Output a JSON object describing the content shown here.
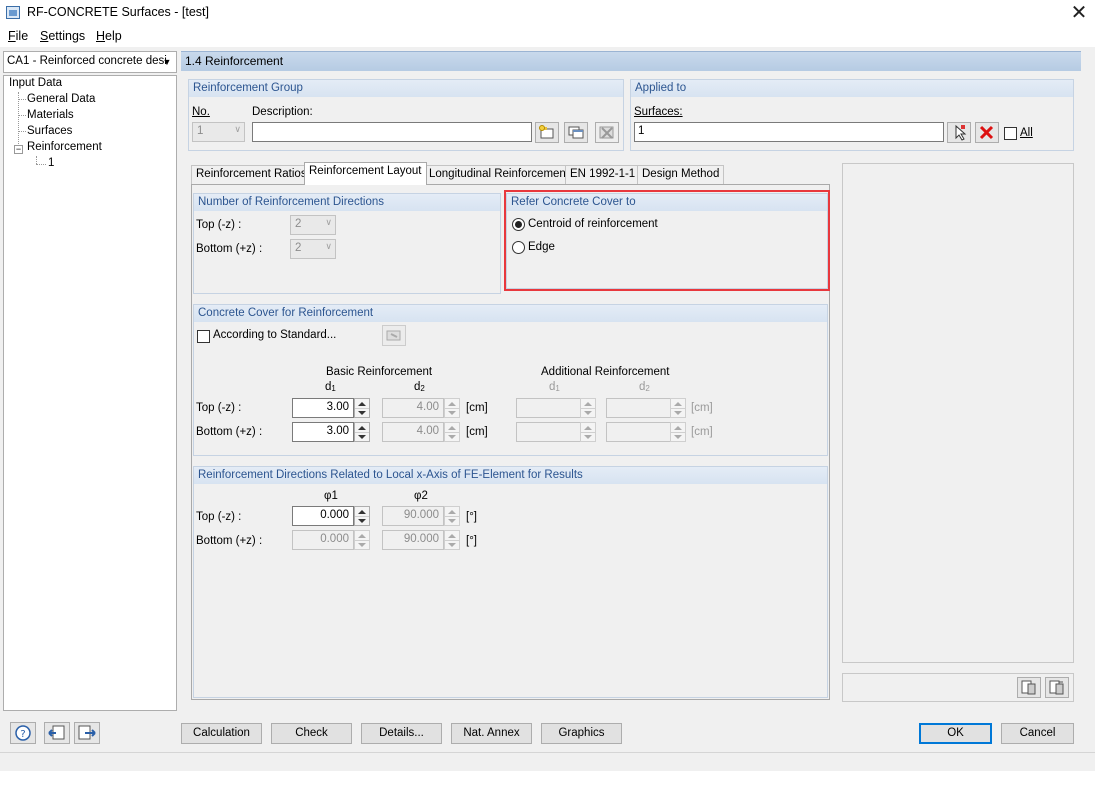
{
  "window": {
    "title": "RF-CONCRETE Surfaces - [test]"
  },
  "menu": {
    "items": [
      "File",
      "Settings",
      "Help"
    ]
  },
  "nav": {
    "case_select": "CA1 - Reinforced concrete desi",
    "root": "Input Data",
    "items": [
      "General Data",
      "Materials",
      "Surfaces",
      "Reinforcement"
    ],
    "sub_item": "1"
  },
  "header": {
    "title": "1.4 Reinforcement"
  },
  "reinforcement_group": {
    "title": "Reinforcement Group",
    "no_label": "No.",
    "no_value": "1",
    "description_label": "Description:",
    "description_value": ""
  },
  "applied_to": {
    "title": "Applied to",
    "surfaces_label": "Surfaces:",
    "surfaces_value": "1",
    "all_label": "All"
  },
  "tabs": [
    {
      "label": "Reinforcement Ratios"
    },
    {
      "label": "Reinforcement Layout"
    },
    {
      "label": "Longitudinal Reinforcement"
    },
    {
      "label": "EN 1992-1-1"
    },
    {
      "label": "Design Method"
    }
  ],
  "num_directions": {
    "title": "Number of Reinforcement Directions",
    "top_label": "Top (-z) :",
    "top_value": "2",
    "bottom_label": "Bottom (+z) :",
    "bottom_value": "2"
  },
  "refer_cover": {
    "title": "Refer Concrete Cover to",
    "option_centroid": "Centroid of reinforcement",
    "option_edge": "Edge"
  },
  "concrete_cover": {
    "title": "Concrete Cover for Reinforcement",
    "according_label": "According to Standard...",
    "basic_heading": "Basic Reinforcement",
    "additional_heading": "Additional Reinforcement",
    "d1": "d",
    "d1_sub": "1",
    "d2": "d",
    "d2_sub": "2",
    "top_label": "Top (-z) :",
    "bottom_label": "Bottom (+z) :",
    "top_d1": "3.00",
    "top_d2": "4.00",
    "bottom_d1": "3.00",
    "bottom_d2": "4.00",
    "unit": "[cm]"
  },
  "directions": {
    "title": "Reinforcement Directions Related to Local x-Axis of FE-Element for Results",
    "phi1": "φ1",
    "phi2": "φ2",
    "top_label": "Top (-z) :",
    "bottom_label": "Bottom (+z) :",
    "top_phi1": "0.000",
    "top_phi2": "90.000",
    "bottom_phi1": "0.000",
    "bottom_phi2": "90.000",
    "unit": "[°]"
  },
  "buttons": {
    "calculation": "Calculation",
    "check": "Check",
    "details": "Details...",
    "nat_annex": "Nat. Annex",
    "graphics": "Graphics",
    "ok": "OK",
    "cancel": "Cancel"
  }
}
